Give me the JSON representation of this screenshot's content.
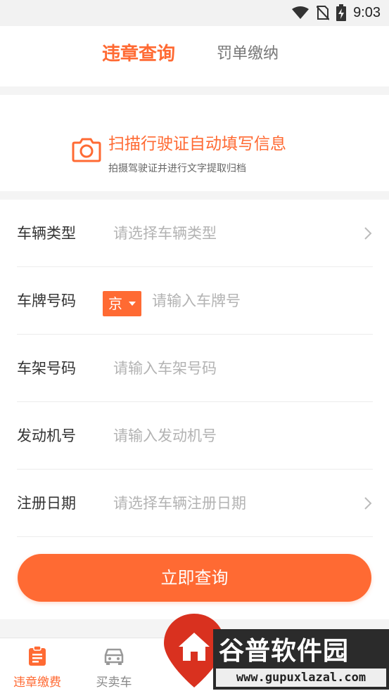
{
  "status_bar": {
    "time": "9:03",
    "icons": [
      "wifi-icon",
      "no-sim-icon",
      "battery-charging-icon"
    ]
  },
  "top_tabs": {
    "active": "违章查询",
    "inactive": "罚单缴纳"
  },
  "scan": {
    "icon": "camera-icon",
    "title": "扫描行驶证自动填写信息",
    "subtitle": "拍摄驾驶证并进行文字提取归档"
  },
  "form": {
    "vehicle_type": {
      "label": "车辆类型",
      "placeholder": "请选择车辆类型"
    },
    "plate": {
      "label": "车牌号码",
      "province": "京",
      "placeholder": "请输入车牌号"
    },
    "frame": {
      "label": "车架号码",
      "placeholder": "请输入车架号码"
    },
    "engine": {
      "label": "发动机号",
      "placeholder": "请输入发动机号"
    },
    "reg_date": {
      "label": "注册日期",
      "placeholder": "请选择车辆注册日期"
    },
    "submit_label": "立即查询"
  },
  "bottom_nav": {
    "items": [
      {
        "label": "违章缴费",
        "icon": "clipboard-icon",
        "active": true
      },
      {
        "label": "买卖车",
        "icon": "car-icon",
        "active": false
      }
    ]
  },
  "watermark": {
    "title": "谷普软件园",
    "url": "www.gupuxlazal.com"
  },
  "colors": {
    "accent": "#ff6a33",
    "placeholder": "#b3b3b3",
    "divider": "#ececec"
  }
}
